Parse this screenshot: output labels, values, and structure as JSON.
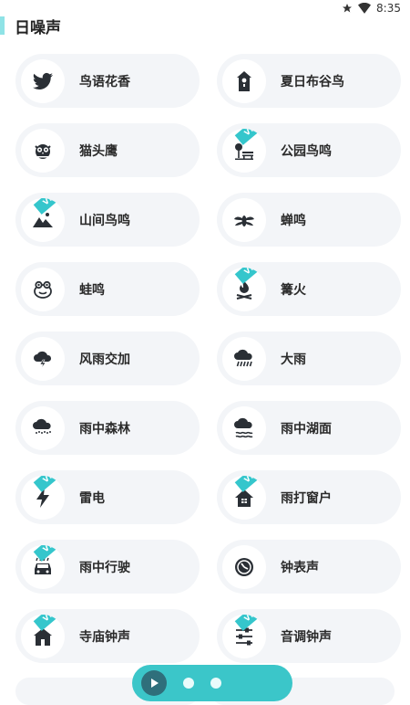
{
  "status": {
    "time": "8:35"
  },
  "header": {
    "title": "日噪声"
  },
  "colors": {
    "accent": "#35c6cc",
    "card_bg": "#f3f5f8",
    "icon": "#2a2f35"
  },
  "items": [
    {
      "label": "鸟语花香",
      "icon": "bird-icon",
      "vip": false
    },
    {
      "label": "夏日布谷鸟",
      "icon": "birdhouse-icon",
      "vip": false
    },
    {
      "label": "猫头鹰",
      "icon": "owl-icon",
      "vip": false
    },
    {
      "label": "公园鸟鸣",
      "icon": "park-bench-icon",
      "vip": true
    },
    {
      "label": "山间鸟鸣",
      "icon": "mountain-icon",
      "vip": true
    },
    {
      "label": "蝉鸣",
      "icon": "cicada-icon",
      "vip": false
    },
    {
      "label": "蛙鸣",
      "icon": "frog-icon",
      "vip": false
    },
    {
      "label": "篝火",
      "icon": "campfire-icon",
      "vip": true
    },
    {
      "label": "风雨交加",
      "icon": "storm-cloud-icon",
      "vip": false
    },
    {
      "label": "大雨",
      "icon": "heavy-rain-icon",
      "vip": false
    },
    {
      "label": "雨中森林",
      "icon": "rain-forest-icon",
      "vip": false
    },
    {
      "label": "雨中湖面",
      "icon": "rain-lake-icon",
      "vip": false
    },
    {
      "label": "雷电",
      "icon": "lightning-icon",
      "vip": true
    },
    {
      "label": "雨打窗户",
      "icon": "house-rain-icon",
      "vip": true
    },
    {
      "label": "雨中行驶",
      "icon": "car-rain-icon",
      "vip": true
    },
    {
      "label": "钟表声",
      "icon": "clock-icon",
      "vip": false
    },
    {
      "label": "寺庙钟声",
      "icon": "temple-icon",
      "vip": true
    },
    {
      "label": "音调钟声",
      "icon": "sliders-icon",
      "vip": true
    }
  ],
  "vip_label": "VIP"
}
